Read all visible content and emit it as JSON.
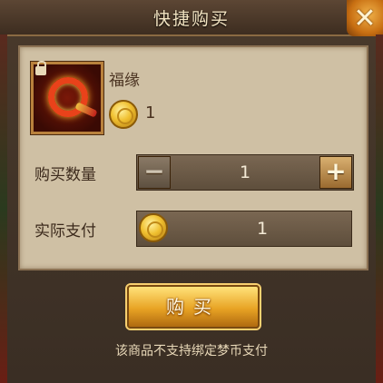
{
  "dialog": {
    "title": "快捷购买",
    "close_icon": "crossed-swords-close-icon"
  },
  "item": {
    "name": "福缘",
    "icon": "red-jade-ring-icon",
    "lock_icon": "lock-icon",
    "price": "1",
    "currency_icon": "gold-coin-icon"
  },
  "quantity": {
    "label": "购买数量",
    "value": "1",
    "minus_label": "−",
    "plus_label": "+"
  },
  "payment": {
    "label": "实际支付",
    "value": "1"
  },
  "buy_button": {
    "label": "购买"
  },
  "notice": "该商品不支持绑定梦币支付"
}
